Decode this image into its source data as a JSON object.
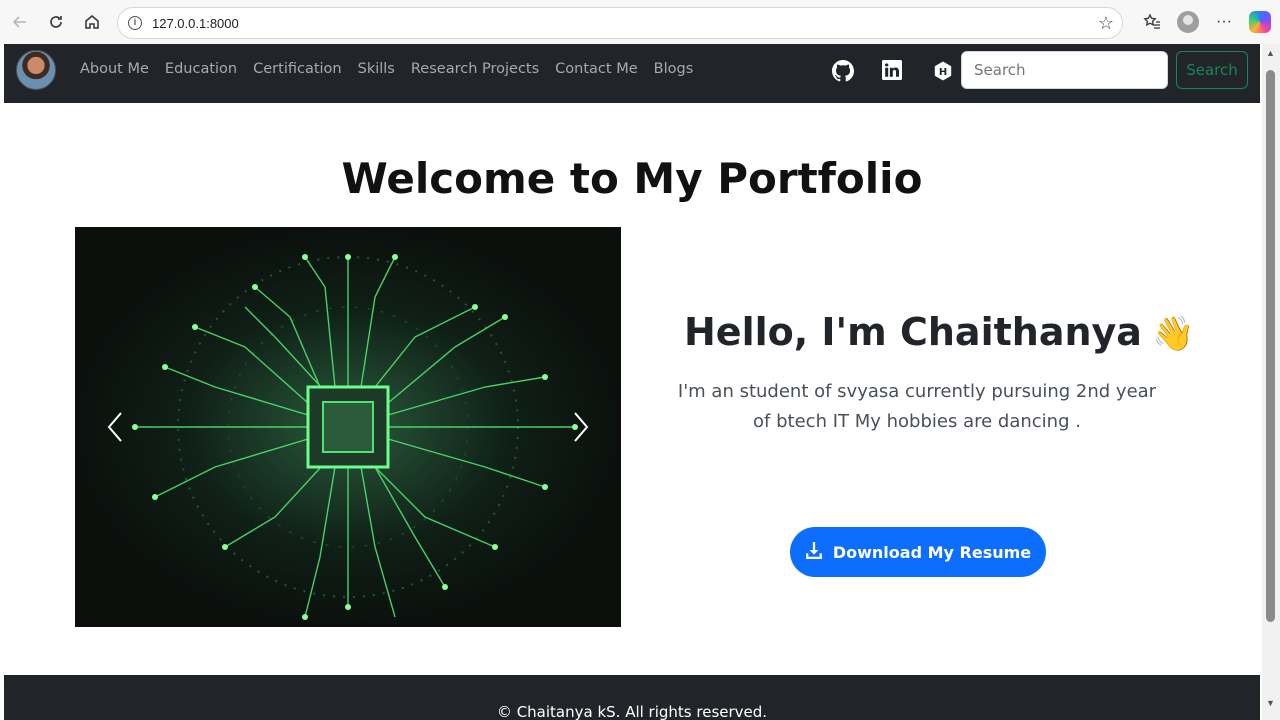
{
  "browser": {
    "url": "127.0.0.1:8000",
    "icons": [
      "back-icon",
      "reload-icon",
      "home-icon",
      "info-icon",
      "star-icon",
      "favorites-icon",
      "profile-icon",
      "more-icon",
      "copilot-icon"
    ]
  },
  "navbar": {
    "links": [
      "About Me",
      "Education",
      "Certification",
      "Skills",
      "Research Projects",
      "Contact Me",
      "Blogs"
    ],
    "social_icons": [
      "github-icon",
      "linkedin-icon",
      "hashnode-icon"
    ],
    "search_placeholder": "Search",
    "search_button": "Search",
    "background": "#212529"
  },
  "main": {
    "title": "Welcome to My Portfolio",
    "hello": "Hello, I'm Chaithanya",
    "wave": "👋",
    "intro": "I'm an student of svyasa currently pursuing 2nd year of btech IT My hobbies are dancing .",
    "resume_button": "Download My Resume",
    "resume_button_color": "#0d6efd"
  },
  "carousel": {
    "image_subject": "green circuit board chip",
    "prev_icon": "chevron-left-icon",
    "next_icon": "chevron-right-icon"
  },
  "footer": {
    "text": "© Chaitanya kS. All rights reserved."
  }
}
